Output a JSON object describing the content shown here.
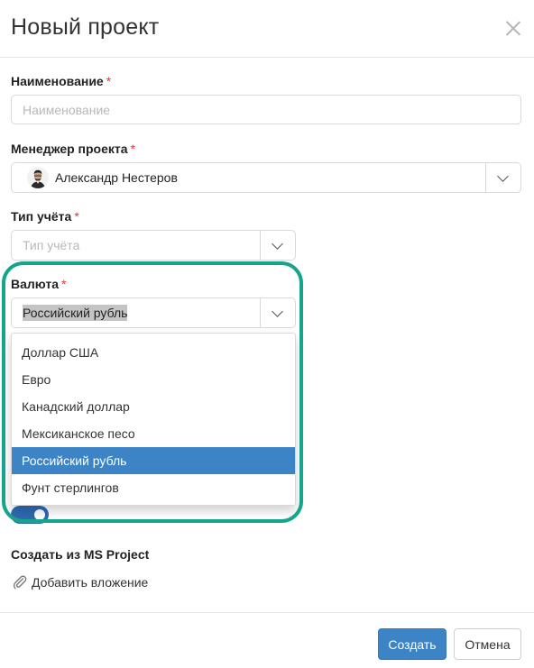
{
  "dialog": {
    "title": "Новый проект"
  },
  "fields": {
    "name": {
      "label": "Наименование",
      "required_mark": "*",
      "value": "",
      "placeholder": "Наименование"
    },
    "manager": {
      "label": "Менеджер проекта",
      "required_mark": "*",
      "value": "Александр Нестеров"
    },
    "accounting_type": {
      "label": "Тип учёта",
      "required_mark": "*",
      "placeholder": "Тип учёта"
    },
    "currency": {
      "label": "Валюта",
      "required_mark": "*",
      "value": "Российский рубль",
      "options": [
        "Доллар США",
        "Евро",
        "Канадский доллар",
        "Мексиканское песо",
        "Российский рубль",
        "Фунт стерлингов"
      ],
      "selected_index": 4
    }
  },
  "toggle": {
    "on": true
  },
  "ms_project": {
    "label": "Создать из MS Project",
    "attach_label": "Добавить вложение"
  },
  "footer": {
    "create_label": "Создать",
    "cancel_label": "Отмена"
  },
  "colors": {
    "primary": "#3d84c6",
    "focus_ring": "#16a58c",
    "required": "#e0383e",
    "toggle": "#2f6ab0"
  },
  "icons": {
    "close": "close-icon",
    "chevron": "chevron-down-icon",
    "attach": "paperclip-icon"
  }
}
